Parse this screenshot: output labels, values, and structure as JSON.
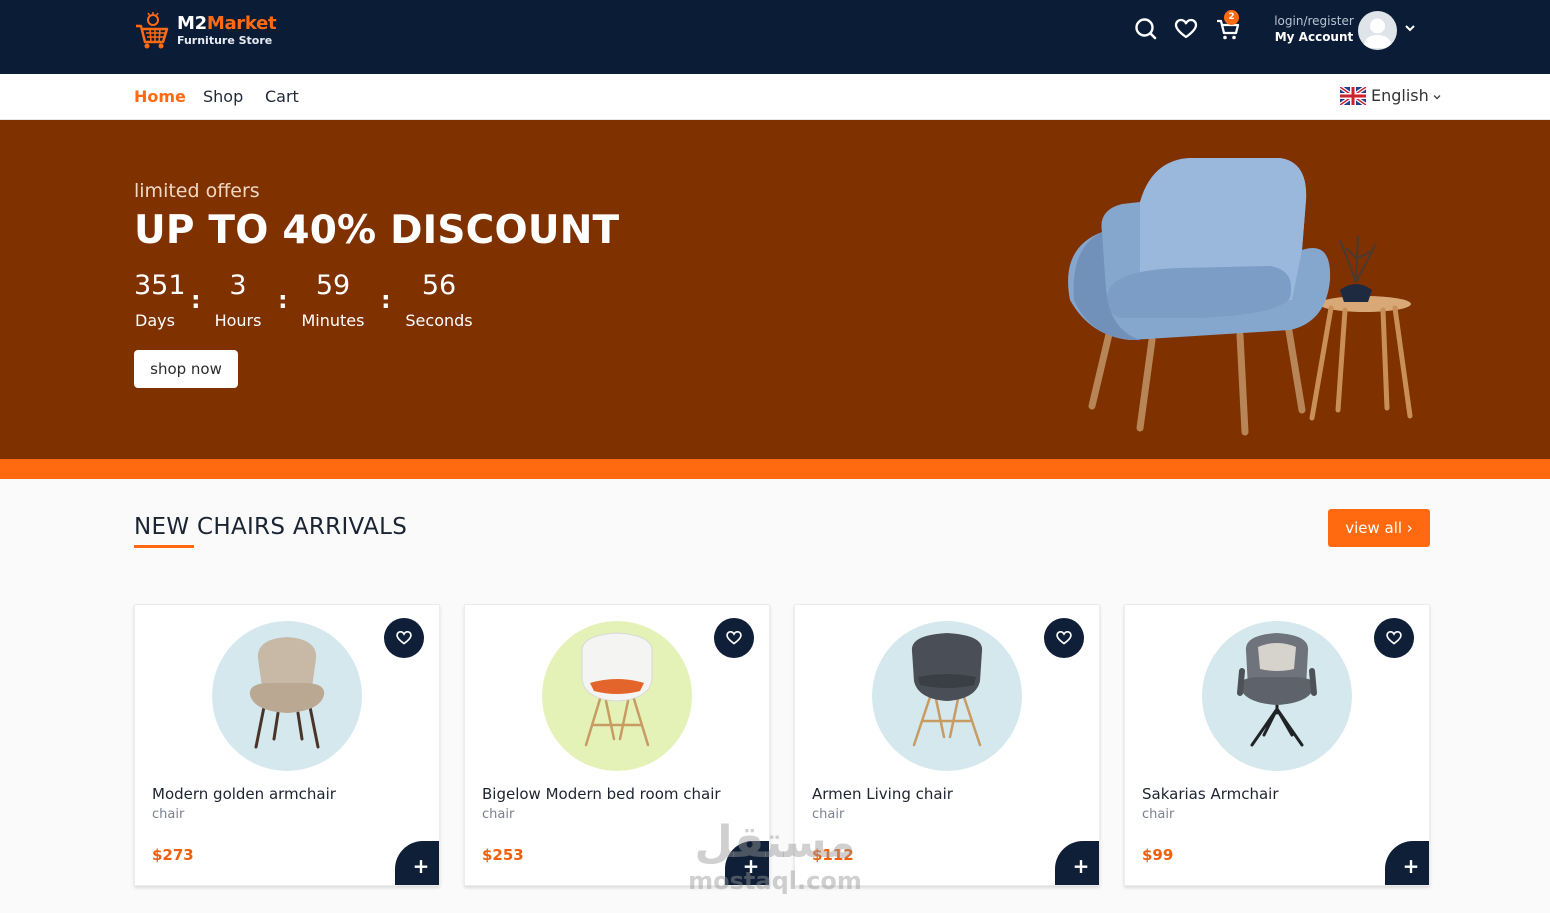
{
  "header": {
    "brand_part1": "M2",
    "brand_part2": "Market",
    "brand_sub": "Furniture Store",
    "cart_count": "2",
    "account_top": "login/register",
    "account_bottom": "My Account",
    "icons": [
      "search-icon",
      "heart-icon",
      "cart-icon",
      "avatar",
      "chevron-down-icon"
    ]
  },
  "nav": {
    "items": [
      "Home",
      "Shop",
      "Cart"
    ],
    "active": "Home",
    "language": "English"
  },
  "hero": {
    "kicker": "limited offers",
    "title": "UP TO 40% DISCOUNT",
    "countdown": [
      {
        "value": "351",
        "label": "Days"
      },
      {
        "value": "3",
        "label": "Hours"
      },
      {
        "value": "59",
        "label": "Minutes"
      },
      {
        "value": "56",
        "label": "Seconds"
      }
    ],
    "separator": ":",
    "button": "shop now"
  },
  "section": {
    "title": "NEW CHAIRS ARRIVALS",
    "view_all": "view all ›"
  },
  "products": [
    {
      "name": "Modern golden armchair",
      "category": "chair",
      "price": "$273",
      "bg": "#d5e8ee"
    },
    {
      "name": "Bigelow Modern bed room chair",
      "category": "chair",
      "price": "$253",
      "bg": "#e4f2b8"
    },
    {
      "name": "Armen Living chair",
      "category": "chair",
      "price": "$112",
      "bg": "#d5e8ee"
    },
    {
      "name": "Sakarias Armchair",
      "category": "chair",
      "price": "$99",
      "bg": "#d5e8ee"
    }
  ],
  "add_symbol": "+",
  "watermark": {
    "arabic": "مستقل",
    "latin": "mostaql.com"
  },
  "colors": {
    "navy": "#0b1d36",
    "orange": "#ff6a13",
    "hero_bg": "#7f3100"
  }
}
